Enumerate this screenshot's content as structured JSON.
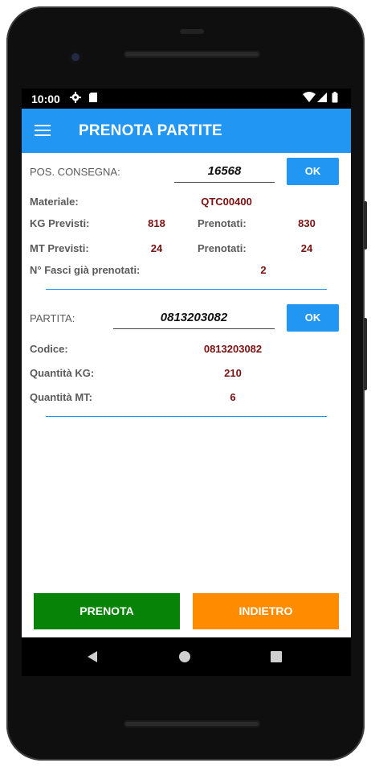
{
  "status": {
    "time": "10:00",
    "icons": [
      "settings-icon",
      "sd-card-icon",
      "wifi-icon",
      "signal-icon",
      "battery-icon"
    ]
  },
  "appbar": {
    "title": "PRENOTA PARTITE",
    "menu_icon": "hamburger-menu-icon"
  },
  "consegna": {
    "label": "POS. CONSEGNA:",
    "value": "16568",
    "ok_label": "OK",
    "materiale_label": "Materiale:",
    "materiale_value": "QTC00400",
    "kg_previsti_label": "KG Previsti:",
    "kg_previsti_value": "818",
    "kg_prenotati_label": "Prenotati:",
    "kg_prenotati_value": "830",
    "mt_previsti_label": "MT Previsti:",
    "mt_previsti_value": "24",
    "mt_prenotati_label": "Prenotati:",
    "mt_prenotati_value": "24",
    "fasci_label": "N° Fasci già prenotati:",
    "fasci_value": "2"
  },
  "partita": {
    "label": "PARTITA:",
    "value": "0813203082",
    "ok_label": "OK",
    "codice_label": "Codice:",
    "codice_value": "0813203082",
    "qta_kg_label": "Quantità KG:",
    "qta_kg_value": "210",
    "qta_mt_label": "Quantità MT:",
    "qta_mt_value": "6"
  },
  "actions": {
    "prenota_label": "PRENOTA",
    "indietro_label": "INDIETRO"
  },
  "colors": {
    "accent": "#2196f3",
    "prenota": "#078407",
    "indietro": "#ff8c00",
    "value_text": "#7a1010"
  },
  "navbar": {
    "icons": [
      "back-icon",
      "home-icon",
      "recents-icon"
    ]
  }
}
